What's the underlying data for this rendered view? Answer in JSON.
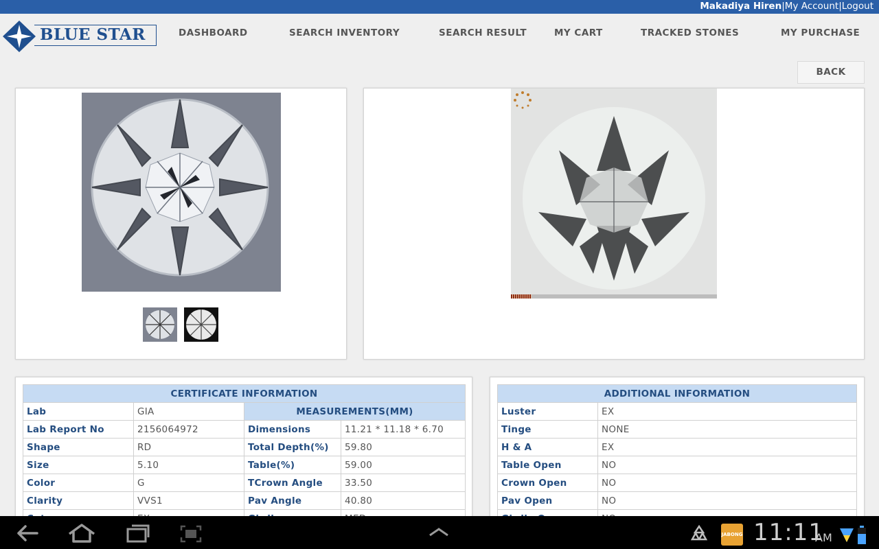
{
  "topbar": {
    "user_name": "Makadiya Hiren",
    "my_account": "My Account",
    "logout": "Logout"
  },
  "header": {
    "logo_text": "BLUE STAR",
    "nav": [
      "DASHBOARD",
      "SEARCH INVENTORY",
      "SEARCH RESULT",
      "MY CART",
      "TRACKED STONES",
      "MY PURCHASE"
    ],
    "back_label": "BACK"
  },
  "certificate": {
    "title": "CERTIFICATE INFORMATION",
    "measurements_title": "MEASUREMENTS(MM)",
    "left_rows": [
      {
        "label": "Lab",
        "value": "GIA"
      },
      {
        "label": "Lab Report No",
        "value": "2156064972"
      },
      {
        "label": "Shape",
        "value": "RD"
      },
      {
        "label": "Size",
        "value": "5.10"
      },
      {
        "label": "Color",
        "value": "G"
      },
      {
        "label": "Clarity",
        "value": "VVS1"
      },
      {
        "label": "Cut",
        "value": "EX"
      }
    ],
    "right_rows": [
      {
        "label": "Dimensions",
        "value": "11.21 * 11.18 * 6.70"
      },
      {
        "label": "Total Depth(%)",
        "value": "59.80"
      },
      {
        "label": "Table(%)",
        "value": "59.00"
      },
      {
        "label": "TCrown Angle",
        "value": "33.50"
      },
      {
        "label": "Pav Angle",
        "value": "40.80"
      },
      {
        "label": "Girdle",
        "value": "MED"
      }
    ]
  },
  "additional": {
    "title": "ADDITIONAL INFORMATION",
    "rows": [
      {
        "label": "Luster",
        "value": "EX"
      },
      {
        "label": "Tinge",
        "value": "NONE"
      },
      {
        "label": "H & A",
        "value": "EX"
      },
      {
        "label": "Table Open",
        "value": "NO"
      },
      {
        "label": "Crown Open",
        "value": "NO"
      },
      {
        "label": "Pav Open",
        "value": "NO"
      },
      {
        "label": "Girdle Open",
        "value": "NO"
      }
    ]
  },
  "system": {
    "time": "11:11",
    "ampm": "AM",
    "app_label": "JABONG"
  },
  "colors": {
    "topbar": "#2a5fa8",
    "brand": "#1f4f8f",
    "table_header": "#c6dbf3",
    "label_text": "#244d80"
  },
  "icons": [
    "back-arrow-icon",
    "home-icon",
    "recent-apps-icon",
    "screenshot-icon",
    "chevron-up-icon",
    "recycle-icon",
    "wifi-icon",
    "battery-icon",
    "loading-spinner-icon"
  ]
}
